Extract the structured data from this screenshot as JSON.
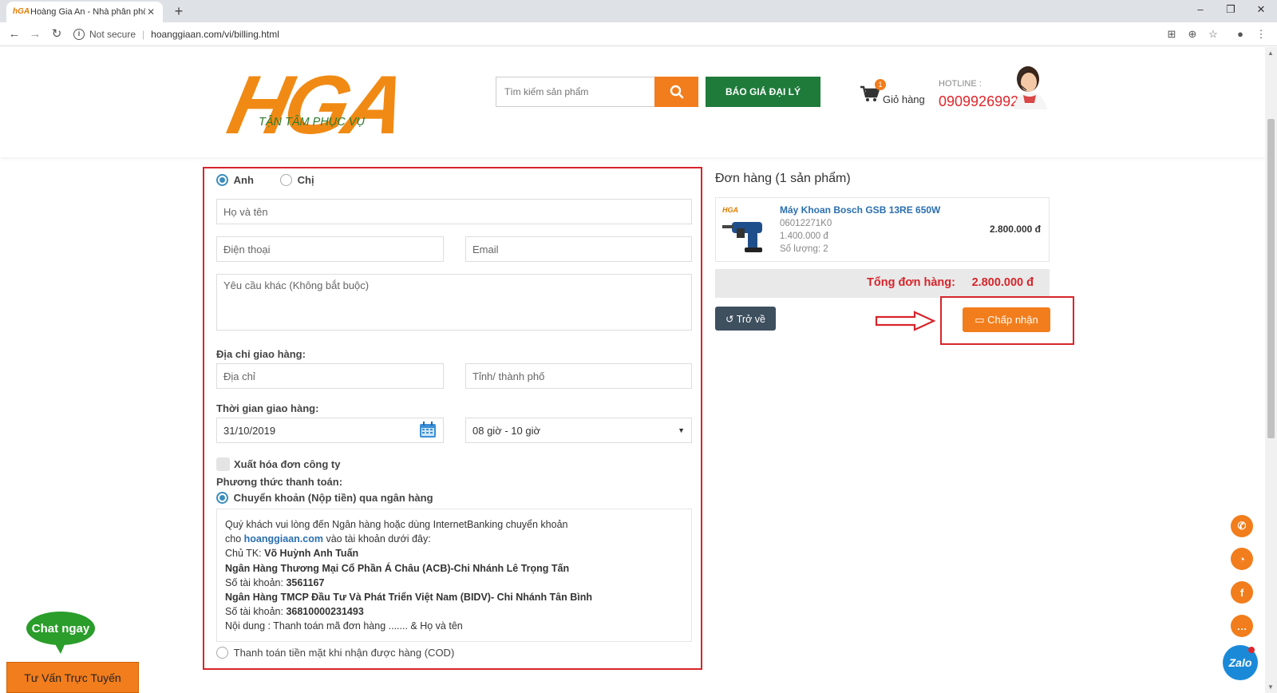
{
  "browser": {
    "tab_title": "Hoàng Gia An - Nhà phân phối s",
    "url_security": "Not secure",
    "url": "hoanggiaan.com/vi/billing.html"
  },
  "header": {
    "logo_text": "HGA",
    "logo_tagline": "TẬN TÂM PHỤC VỤ",
    "search_placeholder": "Tìm kiếm sản phẩm",
    "dealer_button": "BÁO GIÁ ĐẠI LÝ",
    "cart_count": "1",
    "cart_label": "Giỏ hàng",
    "hotline_label": "HOTLINE :",
    "hotline_number": "0909926992"
  },
  "form": {
    "gender_male": "Anh",
    "gender_female": "Chị",
    "name_placeholder": "Họ và tên",
    "phone_placeholder": "Điện thoại",
    "email_placeholder": "Email",
    "note_placeholder": "Yêu cầu khác (Không bắt buộc)",
    "address_label": "Địa chỉ giao hàng:",
    "address_placeholder": "Địa chỉ",
    "city_placeholder": "Tỉnh/ thành phố",
    "time_label": "Thời gian giao hàng:",
    "date_value": "31/10/2019",
    "time_slot": "08 giờ - 10 giờ",
    "invoice_label": "Xuất hóa đơn công ty",
    "payment_label": "Phương thức thanh toán:",
    "payment_transfer": "Chuyển khoản (Nộp tiền) qua ngân hàng",
    "payment_cod": "Thanh toán tiền mặt khi nhận được hàng (COD)"
  },
  "bank": {
    "line1": "Quý khách vui lòng đến Ngân hàng hoặc dùng InternetBanking chuyển khoản",
    "line2_prefix": "cho ",
    "line2_link": "hoanggiaan.com",
    "line2_suffix": " vào tài khoản dưới đây:",
    "owner_label": "Chủ TK: ",
    "owner_name": "Võ Huỳnh Anh Tuấn",
    "bank1_name": "Ngân Hàng Thương Mại Cổ Phần Á Châu (ACB)-Chi Nhánh Lê Trọng Tấn",
    "acct_label": "Số tài khoản: ",
    "bank1_account": "3561167",
    "bank2_name": "Ngân Hàng TMCP Đầu Tư Và Phát Triển Việt Nam (BIDV)- Chi Nhánh Tân Bình",
    "bank2_account": "36810000231493",
    "content_line": "Nội dung : Thanh toán mã đơn hàng ....... & Họ và tên"
  },
  "order": {
    "title": "Đơn hàng (1 sản phẩm)",
    "product_name": "Máy Khoan Bosch GSB 13RE 650W",
    "product_code": "06012271K0",
    "unit_price": "1.400.000 đ",
    "quantity": "Số lượng: 2",
    "line_total": "2.800.000 đ",
    "total_label": "Tổng đơn hàng:",
    "total_value": "2.800.000 đ",
    "back_button": "Trở về",
    "accept_button": "Chấp nhận"
  },
  "floating": {
    "chat_now": "Chat ngay",
    "advise": "Tư Vấn Trực Tuyến",
    "zalo": "Zalo"
  },
  "colors": {
    "brand_orange": "#f27d1c",
    "brand_green": "#1e7b3a",
    "highlight_red": "#d6252b"
  }
}
